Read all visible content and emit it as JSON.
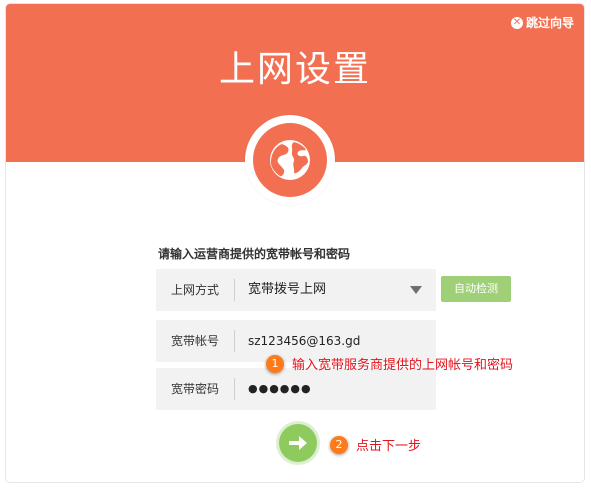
{
  "header": {
    "skip_label": "跳过向导",
    "title": "上网设置"
  },
  "form": {
    "prompt": "请输入运营商提供的宽带帐号和密码",
    "connection_type": {
      "label": "上网方式",
      "value": "宽带拨号上网"
    },
    "auto_detect_label": "自动检测",
    "account": {
      "label": "宽带帐号",
      "value": "sz123456@163.gd"
    },
    "password": {
      "label": "宽带密码",
      "value": "●●●●●●"
    }
  },
  "annotations": {
    "step1_number": "1",
    "step1_text": "输入宽带服务商提供的上网帐号和密码",
    "step2_number": "2",
    "step2_text": "点击下一步"
  },
  "icons": {
    "close": "close-circle-icon",
    "globe": "globe-icon",
    "next": "arrow-right-icon",
    "dropdown": "caret-down-icon"
  },
  "colors": {
    "header": "#f36f52",
    "auto_detect": "#9fcf76",
    "next_button": "#8fca5f",
    "annotation_text": "#e2141d",
    "annotation_badge": "#ff7a1a"
  }
}
